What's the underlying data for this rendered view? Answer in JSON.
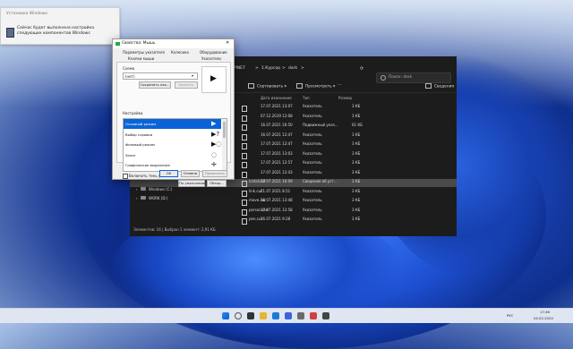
{
  "notification": {
    "title": "Установка Windows",
    "message": "Сейчас будет выполнена настройка следующих компонентов Windows"
  },
  "explorer": {
    "breadcrumb": [
      "YPINE7",
      ">",
      "1.Курсор",
      ">",
      "dark",
      ">"
    ],
    "search_placeholder": "Поиск: dark",
    "toolbar": {
      "sort": "Сортировать",
      "view": "Просмотреть",
      "details": "Сведения"
    },
    "columns": [
      "Дата изменения",
      "Тип",
      "Размер"
    ],
    "rows": [
      {
        "name": "",
        "date": "17.07.2021 13:07",
        "type": "Указатель",
        "size": "3 КБ"
      },
      {
        "name": "",
        "date": "07.12.2019 12:08",
        "type": "Указатель",
        "size": "3 КБ"
      },
      {
        "name": "",
        "date": "16.07.2021 16:50",
        "type": "Подвижный указ...",
        "size": "61 КБ"
      },
      {
        "name": "",
        "date": "16.07.2021 12:47",
        "type": "Указатель",
        "size": "3 КБ"
      },
      {
        "name": "",
        "date": "17.07.2021 12:47",
        "type": "Указатель",
        "size": "3 КБ"
      },
      {
        "name": "",
        "date": "17.07.2021 13:03",
        "type": "Указатель",
        "size": "3 КБ"
      },
      {
        "name": "",
        "date": "17.07.2021 12:57",
        "type": "Указатель",
        "size": "3 КБ"
      },
      {
        "name": "",
        "date": "17.07.2021 12:43",
        "type": "Указатель",
        "size": "3 КБ"
      },
      {
        "name": "install.inf",
        "date": "22.07.2021 16:09",
        "type": "Сведения об уст...",
        "size": "3 КБ"
      },
      {
        "name": "link.cur",
        "date": "21.07.2021 8:51",
        "type": "Указатель",
        "size": "3 КБ"
      },
      {
        "name": "move.cur",
        "date": "16.07.2021 13:48",
        "type": "Указатель",
        "size": "3 КБ"
      },
      {
        "name": "person.cur",
        "date": "17.07.2021 12:58",
        "type": "Указатель",
        "size": "3 КБ"
      },
      {
        "name": "pen.cur",
        "date": "16.07.2021 9:28",
        "type": "Указатель",
        "size": "3 КБ"
      }
    ],
    "nav": [
      {
        "label": "Windows (C:)"
      },
      {
        "label": "WORK (D:)"
      }
    ],
    "status": "Элементов: 16  |  Выбран 1 элемент: 2,91 КБ"
  },
  "dialog": {
    "title": "Свойства: Мышь",
    "tabs_row1": [
      "Параметры указателя",
      "Колесико",
      "Оборудование"
    ],
    "tabs_row2": [
      "Кнопки мыши",
      "Указатели"
    ],
    "scheme_label": "Схема",
    "scheme_value": "(нет)",
    "save_as": "Сохранить как...",
    "delete": "Удалить",
    "settings_label": "Настройка",
    "items": [
      {
        "label": "Основной режим",
        "glyph": "▶"
      },
      {
        "label": "Выбор справки",
        "glyph": "▶?"
      },
      {
        "label": "Фоновый режим",
        "glyph": "▶◌"
      },
      {
        "label": "Занят",
        "glyph": "◌"
      },
      {
        "label": "Графическое выделение",
        "glyph": "✛"
      }
    ],
    "shadow_checkbox": "Включить тень указателя",
    "default_btn": "По умолчанию",
    "browse_btn": "Обзор...",
    "ok": "OK",
    "cancel": "Отмена",
    "apply": "Применить"
  },
  "taskbar": {
    "lang": "РУС",
    "time": "17:46",
    "date": "04.02.2024"
  }
}
